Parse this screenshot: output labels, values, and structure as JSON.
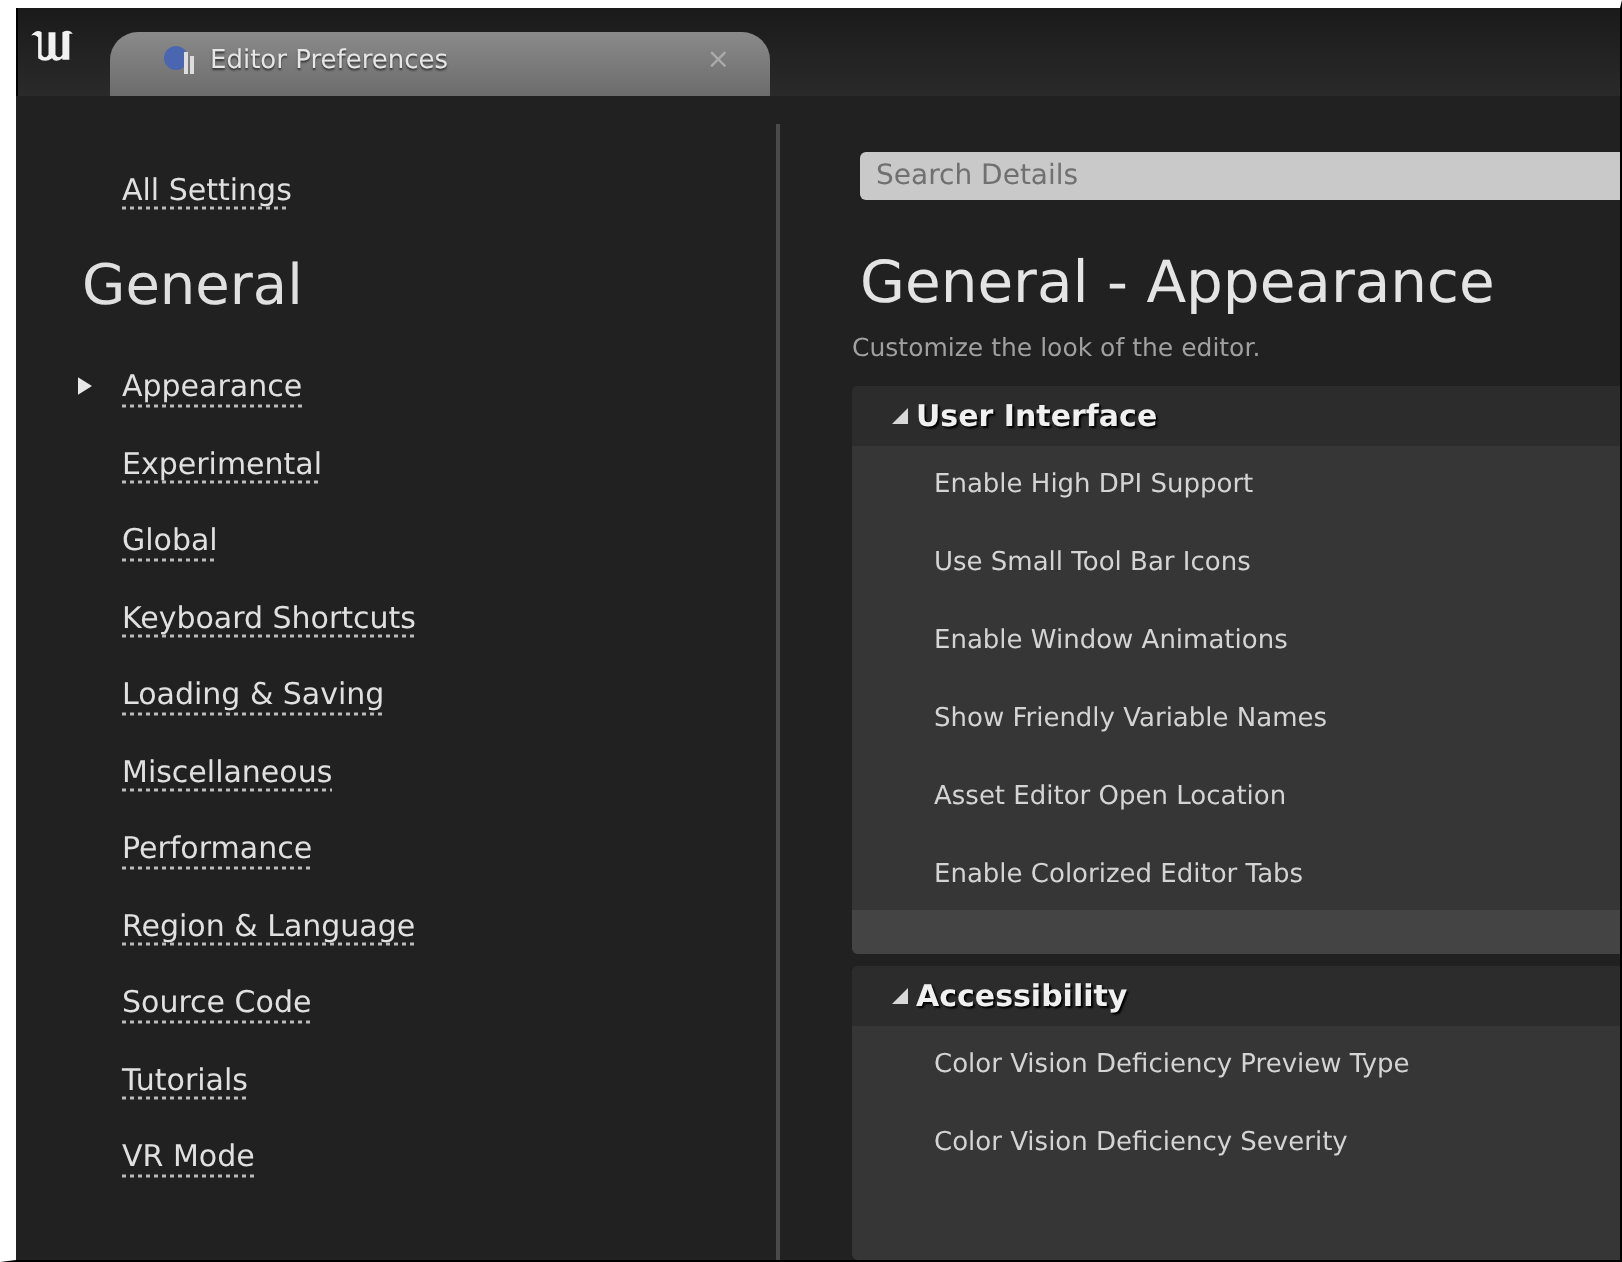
{
  "window": {
    "tab": {
      "title": "Editor Preferences",
      "close": "×"
    }
  },
  "sidebar": {
    "all_settings": "All Settings",
    "heading": "General",
    "items": [
      {
        "label": "Appearance",
        "selected": true
      },
      {
        "label": "Experimental",
        "selected": false
      },
      {
        "label": "Global",
        "selected": false
      },
      {
        "label": "Keyboard Shortcuts",
        "selected": false
      },
      {
        "label": "Loading & Saving",
        "selected": false
      },
      {
        "label": "Miscellaneous",
        "selected": false
      },
      {
        "label": "Performance",
        "selected": false
      },
      {
        "label": "Region & Language",
        "selected": false
      },
      {
        "label": "Source Code",
        "selected": false
      },
      {
        "label": "Tutorials",
        "selected": false
      },
      {
        "label": "VR Mode",
        "selected": false
      }
    ]
  },
  "details": {
    "search": {
      "placeholder": "Search Details"
    },
    "title": "General - Appearance",
    "description": "Customize the look of the editor.",
    "categories": [
      {
        "name": "User Interface",
        "expanded": true,
        "properties": [
          "Enable High DPI Support",
          "Use Small Tool Bar Icons",
          "Enable Window Animations",
          "Show Friendly Variable Names",
          "Asset Editor Open Location",
          "Enable Colorized Editor Tabs"
        ]
      },
      {
        "name": "Accessibility",
        "expanded": true,
        "properties": [
          "Color Vision Deficiency Preview Type",
          "Color Vision Deficiency Severity"
        ]
      }
    ]
  }
}
